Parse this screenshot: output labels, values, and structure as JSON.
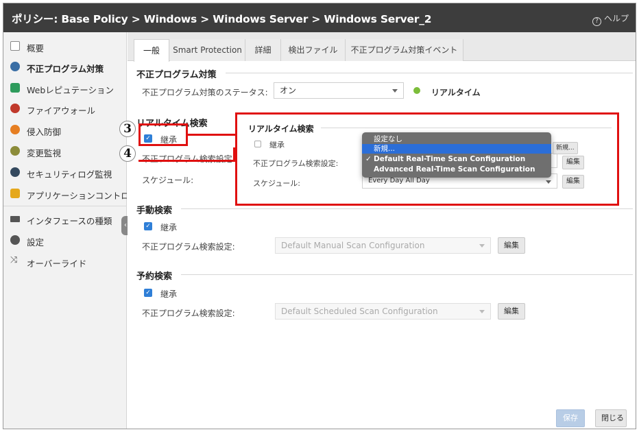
{
  "window": {
    "title": "ポリシー: Base Policy > Windows > Windows Server > Windows Server_2",
    "help_label": "ヘルプ",
    "help_icon": "?"
  },
  "sidebar": {
    "items": [
      {
        "label": "概要",
        "icon": "clipboard-icon",
        "color": "#666666"
      },
      {
        "label": "不正プログラム対策",
        "icon": "biohazard-icon",
        "color": "#3a6ea5"
      },
      {
        "label": "Webレピュテーション",
        "icon": "web-icon",
        "color": "#2e9b5c"
      },
      {
        "label": "ファイアウォール",
        "icon": "firewall-icon",
        "color": "#c0392b"
      },
      {
        "label": "侵入防御",
        "icon": "shield-icon",
        "color": "#e67e22"
      },
      {
        "label": "変更監視",
        "icon": "monitor-icon",
        "color": "#8c8c3a"
      },
      {
        "label": "セキュリティログ監視",
        "icon": "search-icon",
        "color": "#34495e"
      },
      {
        "label": "アプリケーションコントロール",
        "icon": "app-control-icon",
        "color": "#e5a81c"
      },
      {
        "label": "インタフェースの種類",
        "icon": "interface-icon",
        "color": "#555555"
      },
      {
        "label": "設定",
        "icon": "gear-icon",
        "color": "#555555"
      },
      {
        "label": "オーバーライド",
        "icon": "override-icon",
        "color": "#555555"
      }
    ]
  },
  "tabs": [
    {
      "label": "一般"
    },
    {
      "label": "Smart Protection"
    },
    {
      "label": "詳細"
    },
    {
      "label": "検出ファイル"
    },
    {
      "label": "不正プログラム対策イベント"
    }
  ],
  "malware": {
    "title": "不正プログラム対策",
    "status_label": "不正プログラム対策のステータス:",
    "status_value": "オン",
    "realtime_label": "リアルタイム",
    "status_color": "#7cbd3a"
  },
  "realtime": {
    "title": "リアルタイム検索",
    "inherit_label": "継承",
    "config_label": "不正プログラム検索設定:",
    "schedule_label": "スケジュール:"
  },
  "overlay": {
    "title": "リアルタイム検索",
    "inherit_label": "継承",
    "config_label": "不正プログラム検索設定:",
    "schedule_label": "スケジュール:",
    "schedule_value": "Every Day All Day",
    "new_button": "新規...",
    "edit_button": "編集",
    "edit_button2": "編集",
    "dropdown": {
      "items": [
        {
          "label": "設定なし"
        },
        {
          "label": "新規..."
        },
        {
          "label": "Default Real-Time Scan Configuration",
          "check": "✓"
        },
        {
          "label": "Advanced Real-Time Scan Configuration"
        }
      ]
    }
  },
  "manual": {
    "title": "手動検索",
    "inherit_label": "継承",
    "config_label": "不正プログラム検索設定:",
    "config_value": "Default Manual Scan Configuration",
    "edit_button": "編集"
  },
  "scheduled": {
    "title": "予約検索",
    "inherit_label": "継承",
    "config_label": "不正プログラム検索設定:",
    "config_value": "Default Scheduled Scan Configuration",
    "edit_button": "編集"
  },
  "footer": {
    "save_button": "保存",
    "close_button": "閉じる"
  },
  "callouts": {
    "three": "3",
    "four": "4"
  }
}
